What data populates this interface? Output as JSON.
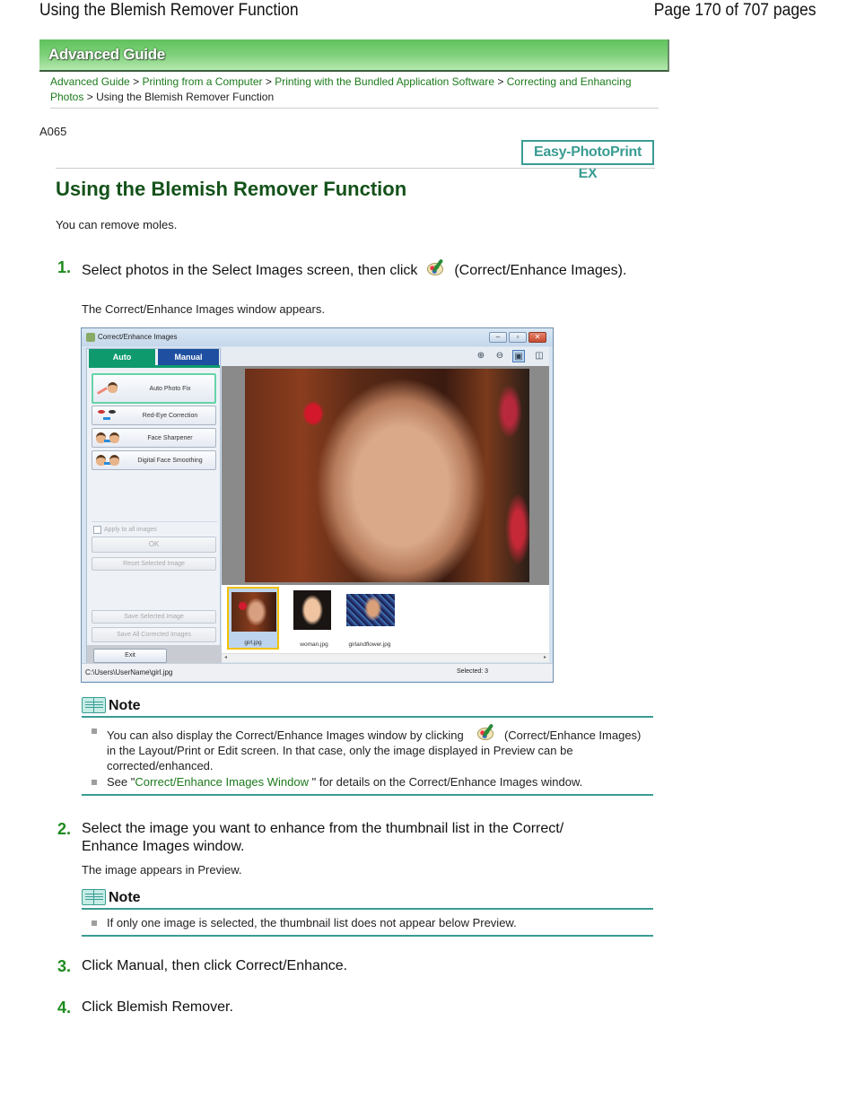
{
  "page_header": {
    "title": "Using the Blemish Remover Function",
    "page_number": "Page 170 of 707 pages"
  },
  "banner": {
    "label": "Advanced Guide"
  },
  "breadcrumb": {
    "items": [
      {
        "label": "Advanced Guide",
        "link": true
      },
      {
        "label": "Printing from a Computer",
        "link": true
      },
      {
        "label": "Printing with the Bundled Application Software",
        "link": true
      },
      {
        "label": "Correcting and Enhancing Photos",
        "link": true
      },
      {
        "label": "Using the Blemish Remover Function",
        "link": false
      }
    ],
    "separator": ">"
  },
  "doc_id": "A065",
  "product_badge": "Easy-PhotoPrint EX",
  "title": "Using the Blemish Remover Function",
  "intro": "You can remove moles.",
  "steps": [
    {
      "num": "1.",
      "text_before_icon": "Select photos in the Select Images screen, then click",
      "icon": "correct-enhance-icon",
      "text_after_icon": "(Correct/Enhance Images).",
      "sub": "The Correct/Enhance Images window appears."
    },
    {
      "num": "2.",
      "text": "Select the image you want to enhance from the thumbnail list in the Correct/ Enhance Images window.",
      "sub": "The image appears in Preview."
    },
    {
      "num": "3.",
      "text": "Click Manual, then click Correct/Enhance."
    },
    {
      "num": "4.",
      "text": "Click Blemish Remover."
    }
  ],
  "app_window": {
    "title": "Correct/Enhance Images",
    "window_buttons": [
      "minimize",
      "maximize",
      "close"
    ],
    "tabs": [
      {
        "label": "Auto",
        "active": true
      },
      {
        "label": "Manual",
        "active": false
      }
    ],
    "function_buttons": [
      {
        "label": "Auto Photo Fix",
        "icon": "auto-photo-fix-icon",
        "active": true
      },
      {
        "label": "Red-Eye Correction",
        "icon": "red-eye-icon",
        "active": false
      },
      {
        "label": "Face Sharpener",
        "icon": "face-sharpener-icon",
        "active": false
      },
      {
        "label": "Digital Face Smoothing",
        "icon": "face-smoothing-icon",
        "active": false
      }
    ],
    "apply_all_label": "Apply to all images",
    "apply_all_checked": false,
    "ok_label": "OK",
    "reset_label": "Reset Selected Image",
    "save_selected_label": "Save Selected Image",
    "save_all_label": "Save All Corrected Images",
    "exit_label": "Exit",
    "toolbar_icons": [
      "zoom-in-icon",
      "zoom-out-icon",
      "whole-image-icon",
      "compare-view-icon"
    ],
    "thumbnails": [
      {
        "caption": "girl.jpg",
        "selected": true
      },
      {
        "caption": "woman.jpg",
        "selected": false
      },
      {
        "caption": "girlandflower.jpg",
        "selected": false
      }
    ],
    "status_path": "C:\\Users\\UserName\\girl.jpg",
    "status_selected": "Selected: 3"
  },
  "notes": [
    {
      "label": "Note",
      "items": [
        {
          "text_before_icon": "You can also display the Correct/Enhance Images window by clicking",
          "icon": "correct-enhance-icon",
          "text_after_icon": "(Correct/Enhance Images) in the Layout/Print or Edit screen. In that case, only the image displayed in Preview can be corrected/enhanced."
        },
        {
          "prefix": "See \"",
          "link": "Correct/Enhance Images Window",
          "suffix": " \" for details on the Correct/Enhance Images window."
        }
      ]
    },
    {
      "label": "Note",
      "items": [
        {
          "text": "If only one image is selected, the thumbnail list does not appear below Preview."
        }
      ]
    }
  ],
  "colors": {
    "link_green": "#1c7a1c",
    "title_green": "#14521a",
    "step_number_green": "#1c8a1c",
    "note_teal": "#3a9c93",
    "banner_green": "#5fc25c"
  }
}
